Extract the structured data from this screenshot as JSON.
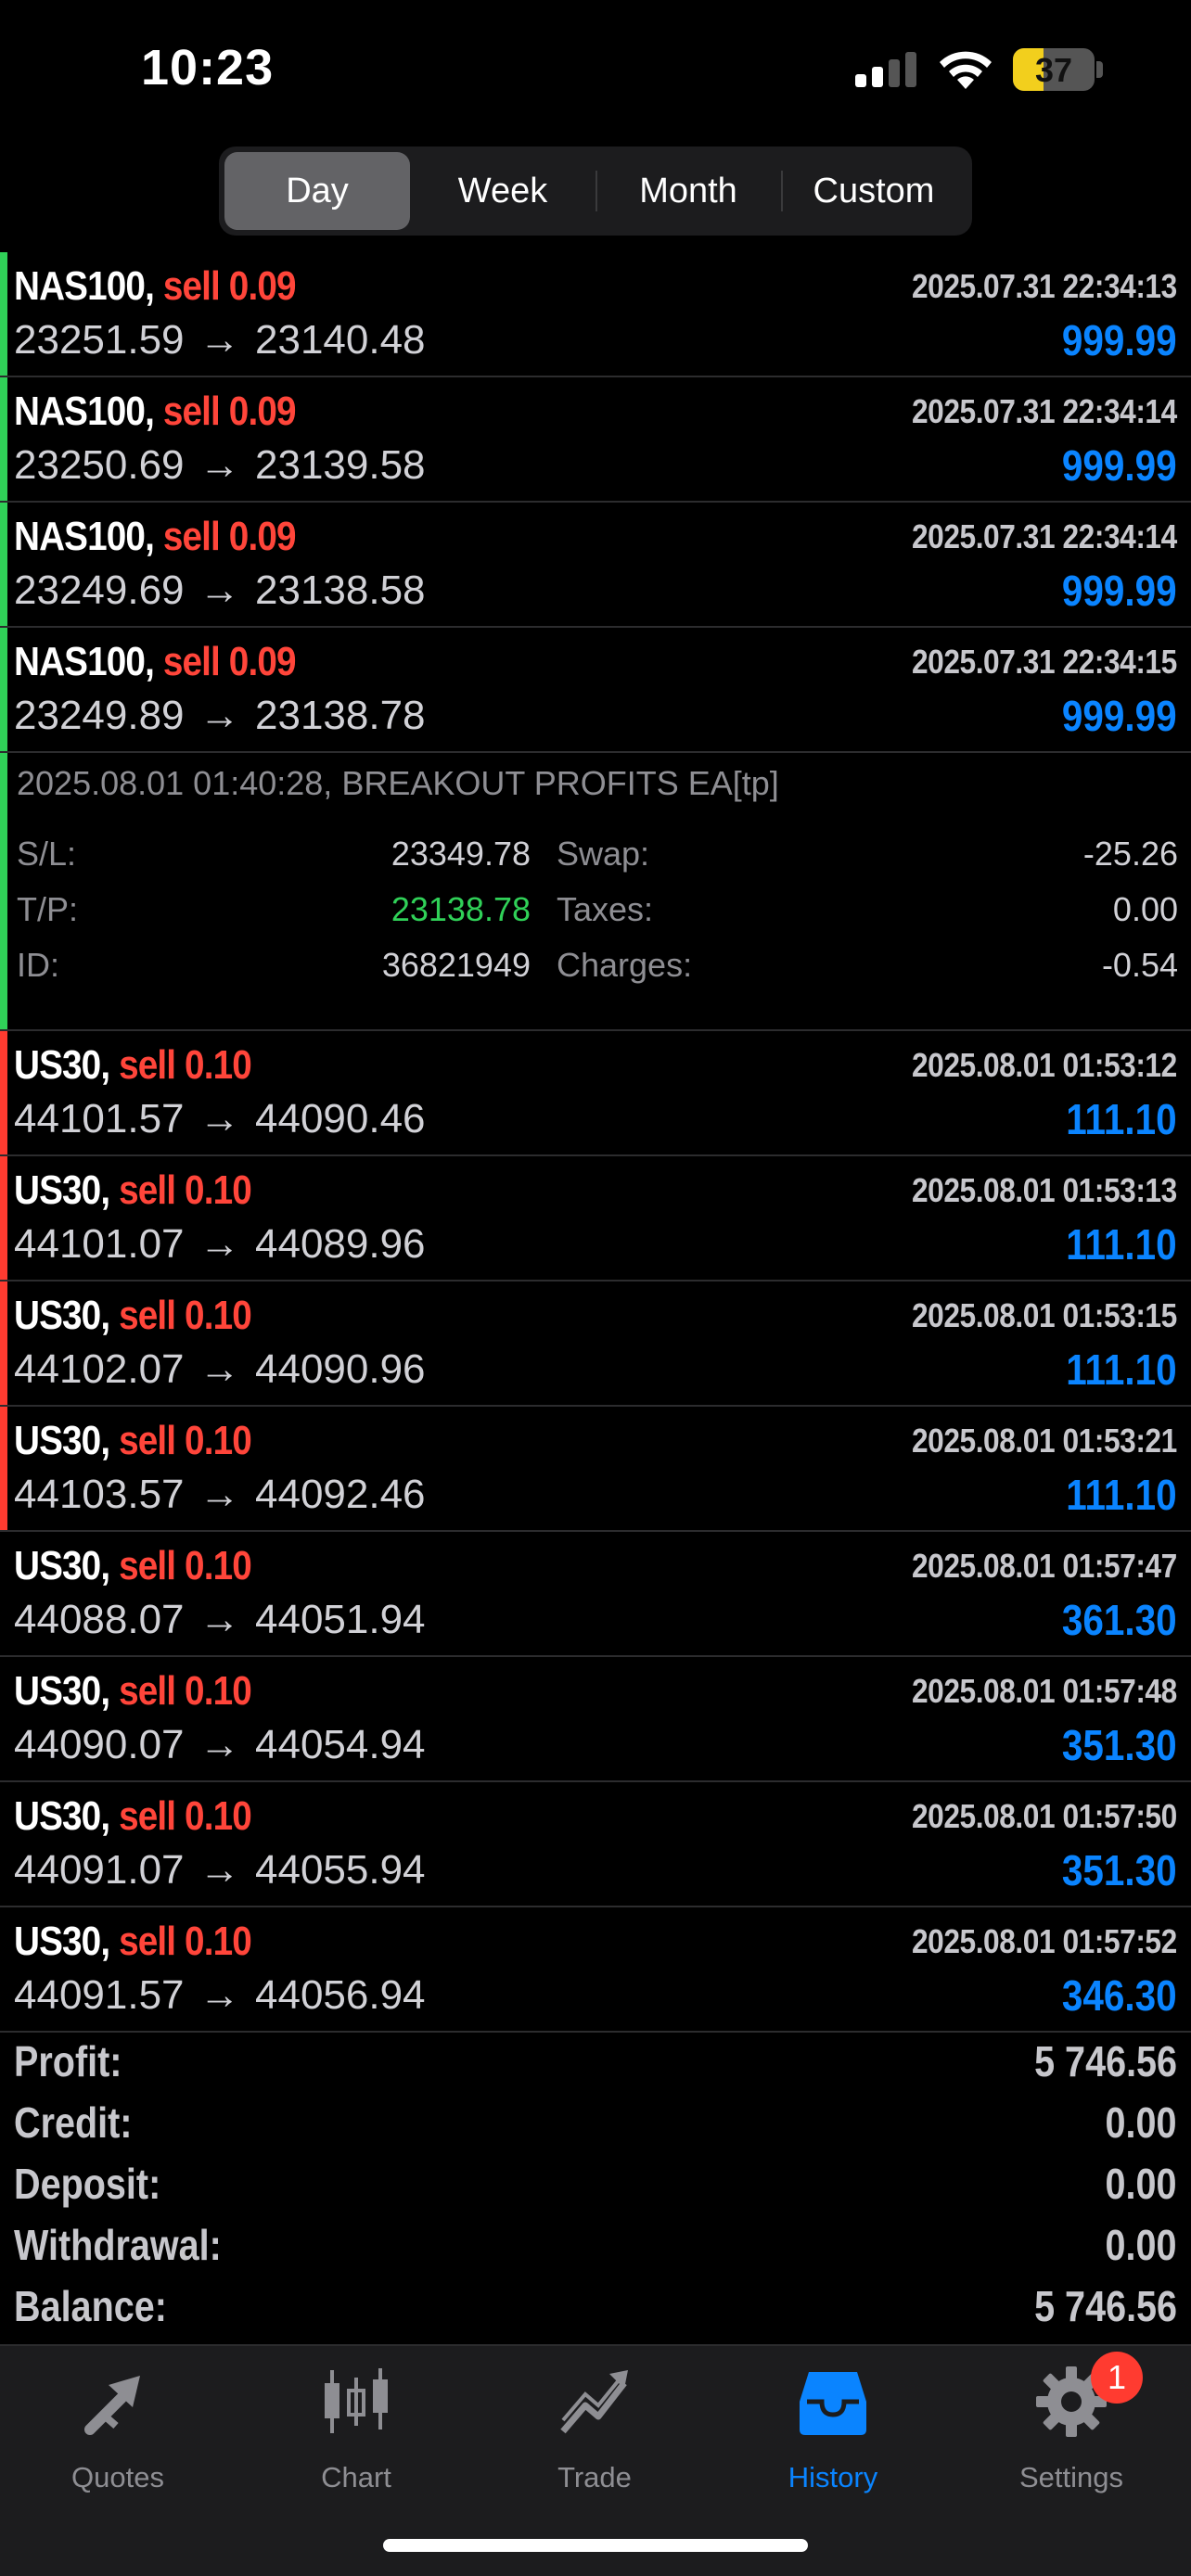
{
  "status_bar": {
    "time": "10:23",
    "battery": "37",
    "battery_level": 0.37
  },
  "period_tabs": [
    {
      "label": "Day",
      "active": true
    },
    {
      "label": "Week",
      "active": false
    },
    {
      "label": "Month",
      "active": false
    },
    {
      "label": "Custom",
      "active": false
    }
  ],
  "colors": {
    "accent": "#0a84ff",
    "sell": "#ff453a",
    "green_bar": "#30d158",
    "red_bar": "#ff3b30",
    "tp_value": "#30d158"
  },
  "deals": [
    {
      "symbol": "NAS100,",
      "side": "sell 0.09",
      "open": "23251.59",
      "close": "23140.48",
      "datetime": "2025.07.31 22:34:13",
      "profit": "999.99",
      "bar": "green"
    },
    {
      "symbol": "NAS100,",
      "side": "sell 0.09",
      "open": "23250.69",
      "close": "23139.58",
      "datetime": "2025.07.31 22:34:14",
      "profit": "999.99",
      "bar": "green"
    },
    {
      "symbol": "NAS100,",
      "side": "sell 0.09",
      "open": "23249.69",
      "close": "23138.58",
      "datetime": "2025.07.31 22:34:14",
      "profit": "999.99",
      "bar": "green"
    },
    {
      "symbol": "NAS100,",
      "side": "sell 0.09",
      "open": "23249.89",
      "close": "23138.78",
      "datetime": "2025.07.31 22:34:15",
      "profit": "999.99",
      "bar": "green"
    }
  ],
  "details": {
    "comment": "2025.08.01 01:40:28, BREAKOUT PROFITS EA[tp]",
    "sl_label": "S/L:",
    "sl_value": "23349.78",
    "tp_label": "T/P:",
    "tp_value": "23138.78",
    "id_label": "ID:",
    "id_value": "36821949",
    "swap_label": "Swap:",
    "swap_value": "-25.26",
    "taxes_label": "Taxes:",
    "taxes_value": "0.00",
    "charges_label": "Charges:",
    "charges_value": "-0.54"
  },
  "deals2": [
    {
      "symbol": "US30,",
      "side": "sell 0.10",
      "open": "44101.57",
      "close": "44090.46",
      "datetime": "2025.08.01 01:53:12",
      "profit": "111.10",
      "bar": "red"
    },
    {
      "symbol": "US30,",
      "side": "sell 0.10",
      "open": "44101.07",
      "close": "44089.96",
      "datetime": "2025.08.01 01:53:13",
      "profit": "111.10",
      "bar": "red"
    },
    {
      "symbol": "US30,",
      "side": "sell 0.10",
      "open": "44102.07",
      "close": "44090.96",
      "datetime": "2025.08.01 01:53:15",
      "profit": "111.10",
      "bar": "red"
    },
    {
      "symbol": "US30,",
      "side": "sell 0.10",
      "open": "44103.57",
      "close": "44092.46",
      "datetime": "2025.08.01 01:53:21",
      "profit": "111.10",
      "bar": "red"
    },
    {
      "symbol": "US30,",
      "side": "sell 0.10",
      "open": "44088.07",
      "close": "44051.94",
      "datetime": "2025.08.01 01:57:47",
      "profit": "361.30",
      "bar": "none"
    },
    {
      "symbol": "US30,",
      "side": "sell 0.10",
      "open": "44090.07",
      "close": "44054.94",
      "datetime": "2025.08.01 01:57:48",
      "profit": "351.30",
      "bar": "none"
    },
    {
      "symbol": "US30,",
      "side": "sell 0.10",
      "open": "44091.07",
      "close": "44055.94",
      "datetime": "2025.08.01 01:57:50",
      "profit": "351.30",
      "bar": "none"
    },
    {
      "symbol": "US30,",
      "side": "sell 0.10",
      "open": "44091.57",
      "close": "44056.94",
      "datetime": "2025.08.01 01:57:52",
      "profit": "346.30",
      "bar": "none"
    }
  ],
  "arrow": "→",
  "summary": [
    {
      "label": "Profit:",
      "value": "5 746.56"
    },
    {
      "label": "Credit:",
      "value": "0.00"
    },
    {
      "label": "Deposit:",
      "value": "0.00"
    },
    {
      "label": "Withdrawal:",
      "value": "0.00"
    },
    {
      "label": "Balance:",
      "value": "5 746.56"
    }
  ],
  "tabbar": [
    {
      "label": "Quotes",
      "icon": "quotes-arrows-icon"
    },
    {
      "label": "Chart",
      "icon": "candlestick-icon"
    },
    {
      "label": "Trade",
      "icon": "trend-line-icon"
    },
    {
      "label": "History",
      "icon": "inbox-tray-icon",
      "active": true
    },
    {
      "label": "Settings",
      "icon": "gear-icon"
    }
  ],
  "settings_badge": "1"
}
